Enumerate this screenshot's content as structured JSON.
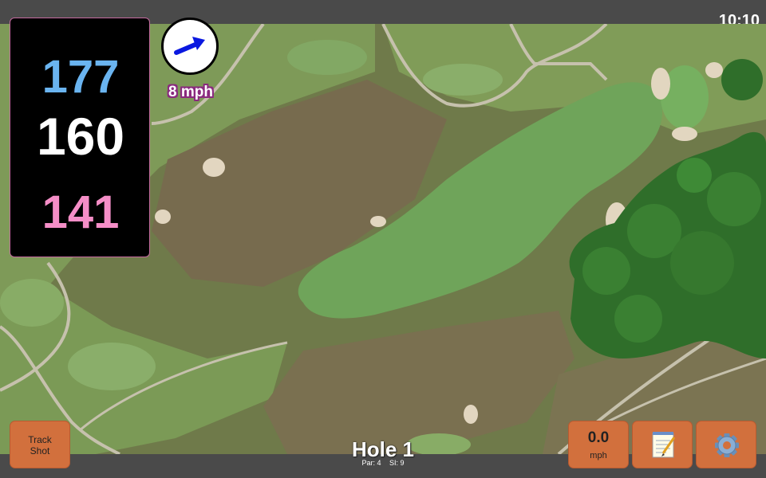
{
  "status": {
    "time": "10:10"
  },
  "distances": {
    "back": "177",
    "middle": "160",
    "front": "141"
  },
  "wind": {
    "speed_label": "8 mph",
    "direction_icon": "arrow-right-icon"
  },
  "hole": {
    "title": "Hole 1",
    "par": "Par: 4",
    "si": "SI: 9"
  },
  "buttons": {
    "track_shot_line1": "Track",
    "track_shot_line2": "Shot",
    "speed_value": "0.0",
    "speed_unit": "mph",
    "notes_icon": "notepad-icon",
    "settings_icon": "gear-icon"
  },
  "colors": {
    "back_distance": "#6ab4f0",
    "middle_distance": "#ffffff",
    "front_distance": "#f58ec7",
    "button": "#d2703d"
  }
}
